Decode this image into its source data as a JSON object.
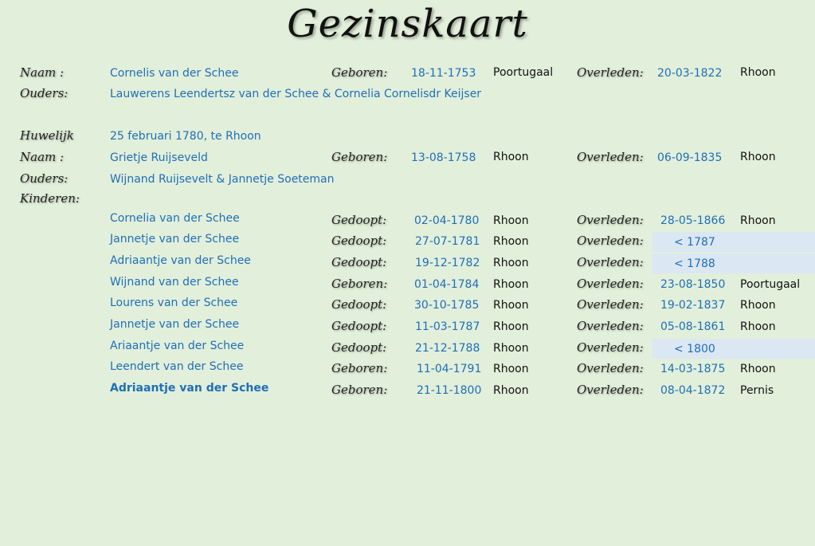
{
  "title": "Gezinskaart",
  "labels": {
    "naam": "Naam :",
    "ouders": "Ouders:",
    "huwelijk": "Huwelijk",
    "kinderen": "Kinderen:",
    "geboren": "Geboren:",
    "overleden": "Overleden:",
    "gedoopt": "Gedoopt:"
  },
  "husband": {
    "name": "Cornelis van der Schee",
    "birth_date": "18-11-1753",
    "birth_place": "Poortugaal",
    "death_date": "20-03-1822",
    "death_place": "Rhoon",
    "parents": "Lauwerens Leendertsz van der Schee & Cornelia Cornelisdr Keijser"
  },
  "marriage": "25 februari 1780, te Rhoon",
  "wife": {
    "name": "Grietje Ruijseveld",
    "birth_date": "13-08-1758",
    "birth_place": "Rhoon",
    "death_date": "06-09-1835",
    "death_place": "Rhoon",
    "parents": "Wijnand Ruijsevelt & Jannetje Soeteman"
  },
  "children": [
    {
      "name": "Cornelia van der Schee",
      "event": "Gedoopt:",
      "date": "02-04-1780",
      "place": "Rhoon",
      "death_date": "28-05-1866",
      "death_place": "Rhoon"
    },
    {
      "name": "Jannetje van der Schee",
      "event": "Gedoopt:",
      "date": "27-07-1781",
      "place": "Rhoon",
      "death_date": "< 1787",
      "death_place": ""
    },
    {
      "name": "Adriaantje van der Schee",
      "event": "Gedoopt:",
      "date": "19-12-1782",
      "place": "Rhoon",
      "death_date": "< 1788",
      "death_place": ""
    },
    {
      "name": "Wijnand van der Schee",
      "event": "Geboren:",
      "date": "01-04-1784",
      "place": "Rhoon",
      "death_date": "23-08-1850",
      "death_place": "Poortugaal"
    },
    {
      "name": "Lourens van der Schee",
      "event": "Gedoopt:",
      "date": "30-10-1785",
      "place": "Rhoon",
      "death_date": "19-02-1837",
      "death_place": "Rhoon"
    },
    {
      "name": "Jannetje van der Schee",
      "event": "Gedoopt:",
      "date": "11-03-1787",
      "place": "Rhoon",
      "death_date": "05-08-1861",
      "death_place": "Rhoon"
    },
    {
      "name": "Ariaantje van der Schee",
      "event": "Gedoopt:",
      "date": "21-12-1788",
      "place": "Rhoon",
      "death_date": "< 1800",
      "death_place": ""
    },
    {
      "name": "Leendert van der Schee",
      "event": "Geboren:",
      "date": "11-04-1791",
      "place": "Rhoon",
      "death_date": "14-03-1875",
      "death_place": "Rhoon"
    },
    {
      "name": "Adriaantje van der Schee",
      "event": "Geboren:",
      "date": "21-11-1800",
      "place": "Rhoon",
      "death_date": "08-04-1872",
      "death_place": "Pernis"
    }
  ]
}
